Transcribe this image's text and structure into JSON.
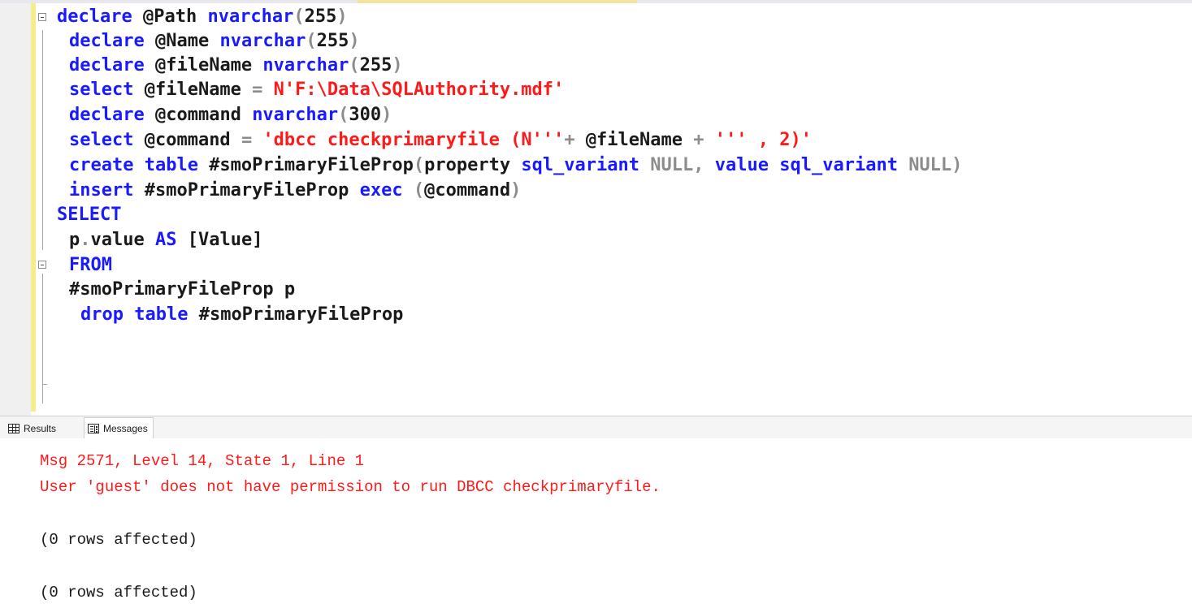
{
  "editor": {
    "lines": [
      {
        "id": "l1",
        "parts": [
          [
            "kw",
            "declare "
          ],
          [
            "var",
            "@Path "
          ],
          [
            "kw",
            "nvarchar"
          ],
          [
            "gray",
            "("
          ],
          [
            "num",
            "255"
          ],
          [
            "gray",
            ")"
          ]
        ]
      },
      {
        "id": "l2",
        "parts": [
          [
            "kw",
            "declare "
          ],
          [
            "var",
            "@Name "
          ],
          [
            "kw",
            "nvarchar"
          ],
          [
            "gray",
            "("
          ],
          [
            "num",
            "255"
          ],
          [
            "gray",
            ")"
          ]
        ]
      },
      {
        "id": "l3",
        "parts": [
          [
            "kw",
            "declare "
          ],
          [
            "var",
            "@fileName "
          ],
          [
            "kw",
            "nvarchar"
          ],
          [
            "gray",
            "("
          ],
          [
            "num",
            "255"
          ],
          [
            "gray",
            ")"
          ]
        ]
      },
      {
        "id": "l4",
        "parts": [
          [
            "kw",
            "select "
          ],
          [
            "var",
            "@fileName "
          ],
          [
            "gray",
            "= "
          ],
          [
            "str",
            "N'F:\\Data\\SQLAuthority.mdf'"
          ]
        ]
      },
      {
        "id": "l5",
        "parts": [
          [
            "kw",
            "declare "
          ],
          [
            "var",
            "@command "
          ],
          [
            "kw",
            "nvarchar"
          ],
          [
            "gray",
            "("
          ],
          [
            "num",
            "300"
          ],
          [
            "gray",
            ")"
          ]
        ]
      },
      {
        "id": "l6",
        "parts": [
          [
            "kw",
            "select "
          ],
          [
            "var",
            "@command "
          ],
          [
            "gray",
            "= "
          ],
          [
            "str",
            "'dbcc checkprimaryfile (N'''"
          ],
          [
            "gray",
            "+ "
          ],
          [
            "var",
            "@fileName "
          ],
          [
            "gray",
            "+ "
          ],
          [
            "str",
            "''' , 2)'"
          ]
        ]
      },
      {
        "id": "l7",
        "parts": [
          [
            "kw",
            "create table "
          ],
          [
            "dflt",
            "#smoPrimaryFileProp"
          ],
          [
            "gray",
            "("
          ],
          [
            "dflt",
            "property "
          ],
          [
            "kw",
            "sql_variant "
          ],
          [
            "gray",
            "NULL, "
          ],
          [
            "kw",
            "value sql_variant "
          ],
          [
            "gray",
            "NULL)"
          ]
        ]
      },
      {
        "id": "l8",
        "parts": [
          [
            "kw",
            "insert "
          ],
          [
            "dflt",
            "#smoPrimaryFileProp "
          ],
          [
            "kw",
            "exec "
          ],
          [
            "gray",
            "("
          ],
          [
            "var",
            "@command"
          ],
          [
            "gray",
            ")"
          ]
        ]
      },
      {
        "id": "l9",
        "parts": [
          [
            "kw",
            "SELECT"
          ]
        ]
      },
      {
        "id": "l10",
        "parts": [
          [
            "dflt",
            "p"
          ],
          [
            "gray",
            "."
          ],
          [
            "dflt",
            "value "
          ],
          [
            "kw",
            "AS "
          ],
          [
            "dflt",
            "[Value]"
          ]
        ]
      },
      {
        "id": "l11",
        "parts": [
          [
            "kw",
            "FROM"
          ]
        ]
      },
      {
        "id": "l12",
        "parts": [
          [
            "dflt",
            "#smoPrimaryFileProp p"
          ]
        ]
      },
      {
        "id": "l13",
        "parts": [
          [
            "kw",
            "drop table "
          ],
          [
            "dflt",
            "#smoPrimaryFileProp"
          ]
        ]
      }
    ]
  },
  "results_tabs": {
    "results_label": "Results",
    "messages_label": "Messages"
  },
  "messages": {
    "error_line1": "Msg 2571, Level 14, State 1, Line 1",
    "error_line2": "User 'guest' does not have permission to run DBCC checkprimaryfile.",
    "rows1": "(0 rows affected)",
    "rows2": "(0 rows affected)"
  },
  "colors": {
    "keyword": "#1a1aff",
    "string": "#ff1a1a",
    "operator": "#8c8c8c",
    "error": "#ff1a1a"
  },
  "icons": [
    "grid-icon",
    "messages-icon",
    "collapse-icon"
  ]
}
